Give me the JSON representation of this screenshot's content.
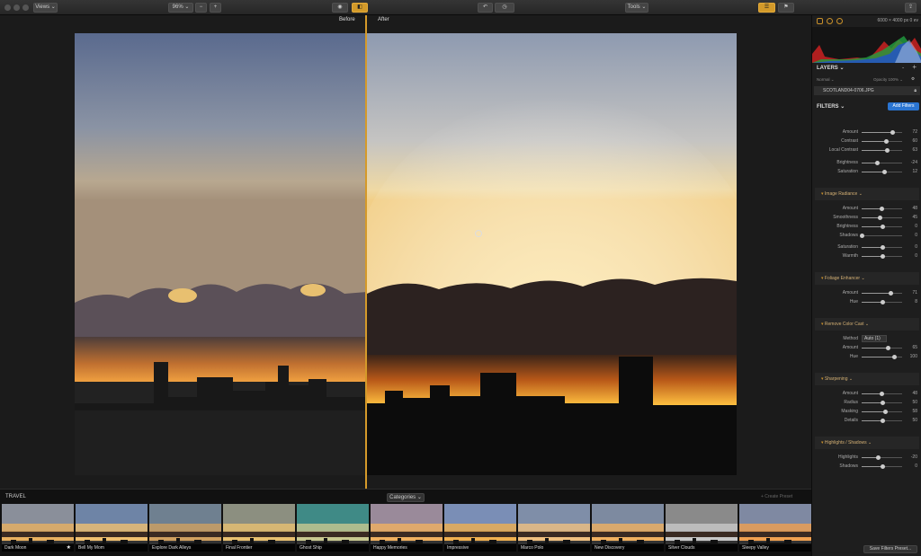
{
  "toolbar": {
    "view_label": "Views ⌄",
    "zoom_label": "96% ⌄",
    "tools_label": "Tools ⌄"
  },
  "viewer": {
    "before_label": "Before",
    "after_label": "After"
  },
  "panel": {
    "image_dims": "6000 × 4000 px    0 ev",
    "layers_label": "LAYERS ⌄",
    "blend_label": "Normal ⌄",
    "opacity_label": "Opacity 100% ⌄",
    "layer_name": "SCOTLAND04-0706.JPG",
    "filters_label": "FILTERS ⌄",
    "add_filters_label": "Add Filters",
    "save_preset_label": "Save Filters Preset...",
    "sections": [
      {
        "title": "",
        "rows": [
          {
            "label": "Amount",
            "value": "72",
            "pos": 0.75
          },
          {
            "label": "Contrast",
            "value": "60",
            "pos": 0.6
          },
          {
            "label": "Local Contrast",
            "value": "63",
            "pos": 0.63
          },
          {
            "label": "Brightness",
            "value": "-24",
            "pos": 0.38
          },
          {
            "label": "Saturation",
            "value": "12",
            "pos": 0.56
          }
        ]
      },
      {
        "title": "Image Radiance ⌄",
        "rows": [
          {
            "label": "Amount",
            "value": "48",
            "pos": 0.48
          },
          {
            "label": "Smoothness",
            "value": "45",
            "pos": 0.45
          },
          {
            "label": "Brightness",
            "value": "0",
            "pos": 0.5
          },
          {
            "label": "Shadows",
            "value": "0",
            "pos": 0.0
          },
          {
            "label": "Saturation",
            "value": "0",
            "pos": 0.5
          },
          {
            "label": "Warmth",
            "value": "0",
            "pos": 0.5
          }
        ]
      },
      {
        "title": "Foliage Enhancer ⌄",
        "rows": [
          {
            "label": "Amount",
            "value": "71",
            "pos": 0.71
          },
          {
            "label": "Hue",
            "value": "8",
            "pos": 0.5
          }
        ]
      },
      {
        "title": "Remove Color Cast ⌄",
        "rows": [
          {
            "label": "Method",
            "value": "",
            "select": "Auto (1)"
          },
          {
            "label": "Amount",
            "value": "65",
            "pos": 0.65
          },
          {
            "label": "Hue",
            "value": "100",
            "pos": 0.8
          }
        ]
      },
      {
        "title": "Sharpening ⌄",
        "rows": [
          {
            "label": "Amount",
            "value": "48",
            "pos": 0.48
          },
          {
            "label": "Radius",
            "value": "50",
            "pos": 0.5
          },
          {
            "label": "Masking",
            "value": "58",
            "pos": 0.58
          },
          {
            "label": "Details",
            "value": "50",
            "pos": 0.5
          }
        ]
      },
      {
        "title": "Highlights / Shadows ⌄",
        "rows": [
          {
            "label": "Highlights",
            "value": "-20",
            "pos": 0.4
          },
          {
            "label": "Shadows",
            "value": "0",
            "pos": 0.5
          }
        ]
      }
    ]
  },
  "filmstrip": {
    "title": "TRAVEL",
    "category_label": "Categories ⌄",
    "create_label": "+ Create Preset",
    "items": [
      {
        "label": "Dark Moon",
        "tone": "#8a8f9a",
        "glow": "#e8b060"
      },
      {
        "label": "Bell My Mom",
        "tone": "#6e84a6",
        "glow": "#f0c070"
      },
      {
        "label": "Explore Dark Alleys",
        "tone": "#6f8090",
        "glow": "#d0a060"
      },
      {
        "label": "Final Frontier",
        "tone": "#8c8f80",
        "glow": "#e8c070"
      },
      {
        "label": "Ghost Ship",
        "tone": "#3f8a86",
        "glow": "#c8c890"
      },
      {
        "label": "Happy Memories",
        "tone": "#9a8a9a",
        "glow": "#f0b060"
      },
      {
        "label": "Impressive",
        "tone": "#7a8eb6",
        "glow": "#f0b050"
      },
      {
        "label": "Marco Polo",
        "tone": "#7f8ea8",
        "glow": "#f0c080"
      },
      {
        "label": "New Discovery",
        "tone": "#7d8aa0",
        "glow": "#f0b060"
      },
      {
        "label": "Silver Clouds",
        "tone": "#8a8a8a",
        "glow": "#c8c8c8"
      },
      {
        "label": "Sleepy Valley",
        "tone": "#7f89a2",
        "glow": "#f0a050"
      }
    ]
  }
}
